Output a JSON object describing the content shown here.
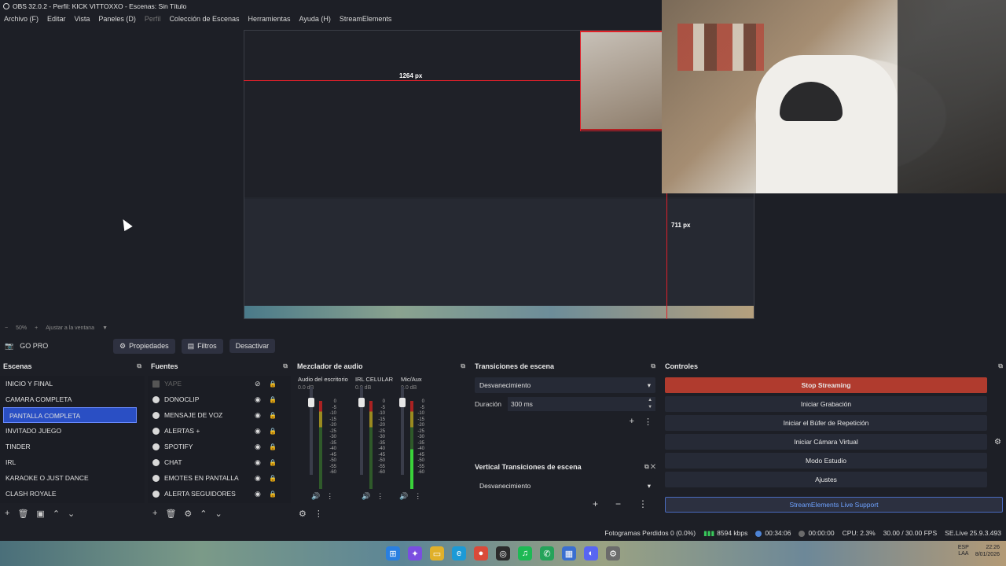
{
  "window": {
    "title": "OBS 32.0.2 - Perfil: KICK VITTOXXO - Escenas: Sin Título"
  },
  "menu": [
    "Archivo (F)",
    "Editar",
    "Vista",
    "Paneles (D)",
    "Perfil",
    "Colección de Escenas",
    "Herramientas",
    "Ayuda (H)",
    "StreamElements"
  ],
  "preview": {
    "guide_h": "1264 px",
    "guide_v": "711 px"
  },
  "zoom": {
    "percent": "50%",
    "fit_label": "Ajustar a la ventana"
  },
  "source_toolbar": {
    "source_name": "GO PRO",
    "properties": "Propiedades",
    "filters": "Filtros",
    "deactivate": "Desactivar"
  },
  "docks": {
    "scenes_title": "Escenas",
    "sources_title": "Fuentes",
    "mixer_title": "Mezclador de audio",
    "transitions_title": "Transiciones de escena",
    "vertical_title": "Vertical Transiciones de escena",
    "controls_title": "Controles"
  },
  "scenes": [
    "INICIO Y FINAL",
    "CAMARA COMPLETA",
    "PANTALLA COMPLETA",
    "INVITADO JUEGO",
    "TINDER",
    "IRL",
    "KARAOKE O JUST DANCE",
    "CLASH ROYALE"
  ],
  "selected_scene": "PANTALLA COMPLETA",
  "sources": [
    "YAPE",
    "DONOCLIP",
    "MENSAJE DE VOZ",
    "ALERTAS +",
    "SPOTIFY",
    "CHAT",
    "EMOTES EN PANTALLA",
    "ALERTA SEGUIDORES"
  ],
  "mixer": [
    {
      "name": "Audio del escritorio",
      "db": "0.0 dB"
    },
    {
      "name": "IRL CELULAR",
      "db": "0.0 dB"
    },
    {
      "name": "Mic/Aux",
      "db": "0.0 dB"
    }
  ],
  "mixer_scale": [
    "0",
    "-5",
    "-10",
    "-15",
    "-20",
    "-25",
    "-30",
    "-35",
    "-40",
    "-45",
    "-50",
    "-55",
    "-60"
  ],
  "transitions": {
    "selected": "Desvanecimiento",
    "duration_label": "Duración",
    "duration_value": "300 ms"
  },
  "vertical_transitions": {
    "selected": "Desvanecimiento"
  },
  "controls": {
    "stop_streaming": "Stop Streaming",
    "start_recording": "Iniciar Grabación",
    "replay_buffer": "Iniciar el Búfer de Repetición",
    "virtual_camera": "Iniciar Cámara Virtual",
    "studio_mode": "Modo Estudio",
    "settings": "Ajustes",
    "se_support": "StreamElements Live Support"
  },
  "status": {
    "dropped_frames": "Fotogramas Perdidos 0 (0.0%)",
    "bitrate": "8594 kbps",
    "live_time": "00:34:06",
    "rec_time": "00:00:00",
    "cpu": "CPU: 2.3%",
    "fps": "30.00 / 30.00 FPS",
    "se_version": "SE.Live 25.9.3.493"
  },
  "taskbar": {
    "lang1": "ESP",
    "lang2": "LAA",
    "time": "22:26",
    "date": "8/01/2026"
  },
  "colors": {
    "accent": "#2a4fc4",
    "stop": "#b03b2e",
    "bg": "#1d1f26"
  },
  "icons": [
    "app-icon",
    "camera-icon",
    "gear-icon",
    "filter-icon",
    "eye-icon",
    "lock-icon",
    "pop-out-icon",
    "close-icon",
    "plus-icon",
    "trash-icon",
    "windows-start-icon"
  ]
}
